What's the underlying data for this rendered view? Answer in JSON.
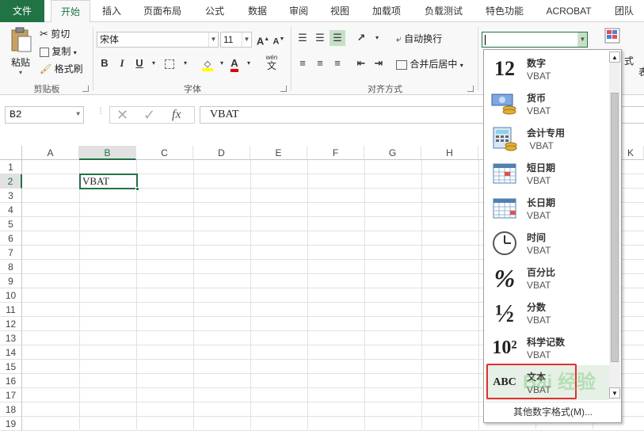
{
  "tabs": [
    {
      "label": "文件"
    },
    {
      "label": "开始"
    },
    {
      "label": "插入"
    },
    {
      "label": "页面布局"
    },
    {
      "label": "公式"
    },
    {
      "label": "数据"
    },
    {
      "label": "审阅"
    },
    {
      "label": "视图"
    },
    {
      "label": "加载项"
    },
    {
      "label": "负载测试"
    },
    {
      "label": "特色功能"
    },
    {
      "label": "ACROBAT"
    },
    {
      "label": "团队"
    }
  ],
  "clipboard": {
    "paste": "粘贴",
    "cut": "剪切",
    "copy": "复制",
    "format_painter": "格式刷",
    "group_label": "剪贴板"
  },
  "font": {
    "name": "宋体",
    "size": "11",
    "group_label": "字体",
    "bold": "B",
    "italic": "I",
    "underline": "U",
    "wen": "wén",
    "wen_char": "文",
    "grow": "A",
    "shrink": "A"
  },
  "alignment": {
    "wrap_text": "自动换行",
    "merge_center": "合并后居中",
    "group_label": "对齐方式"
  },
  "number_format": {
    "combo_value": "",
    "right_partial": "式",
    "right_partial2": "表"
  },
  "formula_bar": {
    "name_box": "B2",
    "fx": "fx",
    "value": "VBAT"
  },
  "columns": [
    "A",
    "B",
    "C",
    "D",
    "E",
    "F",
    "G",
    "H",
    "K"
  ],
  "rows": [
    "1",
    "2",
    "3",
    "4",
    "5",
    "6",
    "7",
    "8",
    "9",
    "10",
    "11",
    "12",
    "13",
    "14",
    "15",
    "16",
    "17",
    "18",
    "19"
  ],
  "cell_b2": "VBAT",
  "dropdown": {
    "items": [
      {
        "name": "数字",
        "value": "VBAT",
        "icon": "number-icon",
        "glyph": "12"
      },
      {
        "name": "货币",
        "value": "VBAT",
        "icon": "currency-icon"
      },
      {
        "name": "会计专用",
        "value": " VBAT",
        "icon": "accounting-icon"
      },
      {
        "name": "短日期",
        "value": "VBAT",
        "icon": "short-date-icon"
      },
      {
        "name": "长日期",
        "value": "VBAT",
        "icon": "long-date-icon"
      },
      {
        "name": "时间",
        "value": "VBAT",
        "icon": "clock-icon"
      },
      {
        "name": "百分比",
        "value": "VBAT",
        "icon": "percent-icon",
        "glyph": "%"
      },
      {
        "name": "分数",
        "value": "VBAT",
        "icon": "fraction-icon",
        "glyph": "½"
      },
      {
        "name": "科学记数",
        "value": "VBAT",
        "icon": "scientific-icon",
        "glyph": "10²"
      },
      {
        "name": "文本",
        "value": "VBAT",
        "icon": "text-abc-icon",
        "glyph": "ABC"
      }
    ],
    "more": "其他数字格式(M)..."
  },
  "watermark": "Bai 经验",
  "colors": {
    "accent": "#217346",
    "highlight": "#e23030",
    "fill_yellow": "#ffff00",
    "font_red": "#e00000"
  }
}
